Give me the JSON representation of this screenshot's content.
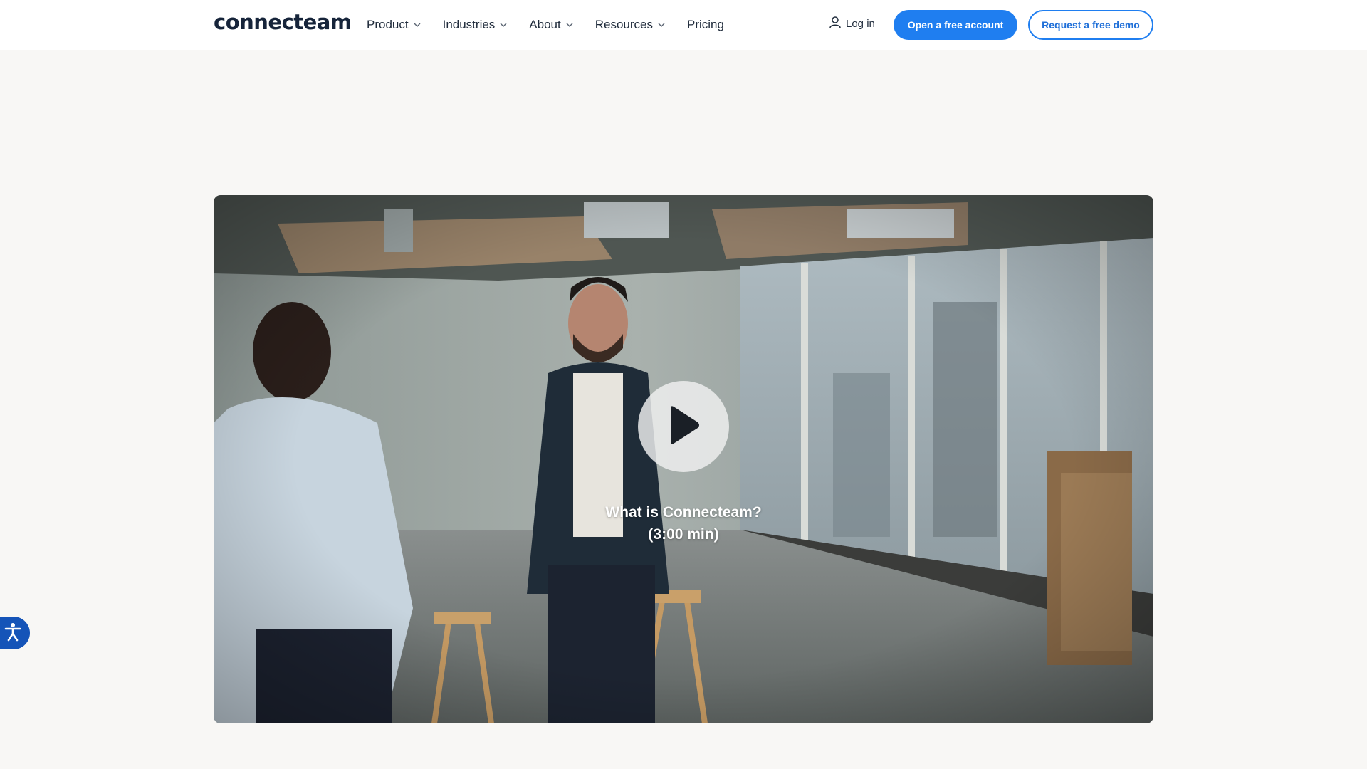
{
  "brand": {
    "name": "connecteam"
  },
  "nav": {
    "items": [
      {
        "label": "Product",
        "has_menu": true
      },
      {
        "label": "Industries",
        "has_menu": true
      },
      {
        "label": "About",
        "has_menu": true
      },
      {
        "label": "Resources",
        "has_menu": true
      },
      {
        "label": "Pricing",
        "has_menu": false
      }
    ],
    "login_label": "Log in",
    "primary_cta": "Open a free account",
    "secondary_cta": "Request a free demo"
  },
  "video": {
    "title": "What is Connecteam?",
    "duration": "(3:00 min)"
  },
  "colors": {
    "page_bg": "#f8f7f5",
    "primary_blue": "#1f7ef0",
    "a11y_blue": "#1554b8",
    "text_dark": "#1f2b3b"
  },
  "icons": {
    "login": "user-icon",
    "chevron": "chevron-down-icon",
    "play": "play-icon",
    "accessibility": "accessibility-icon"
  }
}
